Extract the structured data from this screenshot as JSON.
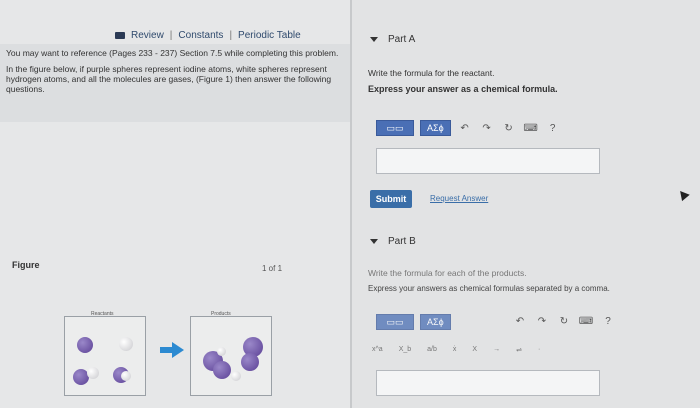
{
  "header": {
    "review_label": "Review",
    "constants_label": "Constants",
    "periodic_label": "Periodic Table",
    "separator": "|"
  },
  "reference": {
    "line1": "You may want to reference (Pages 233 - 237) Section 7.5 while completing this problem.",
    "line2": "In the figure below, if purple spheres represent iodine atoms, white spheres represent hydrogen atoms, and all the molecules are gases, (Figure 1) then answer the following questions."
  },
  "figure": {
    "label": "Figure",
    "page_count": "1 of 1",
    "reactants_caption": "Reactants",
    "products_caption": "Products"
  },
  "part_a": {
    "title": "Part A",
    "instruction": "Write the formula for the reactant.",
    "bold_instruction": "Express your answer as a chemical formula.",
    "answer_value": "",
    "greek_label": "ΑΣϕ",
    "help_label": "?",
    "submit_label": "Submit",
    "request_label": "Request Answer"
  },
  "part_b": {
    "title": "Part B",
    "instruction": "Write the formula for each of the products.",
    "bold_instruction": "Express your answers as chemical formulas separated by a comma.",
    "answer_value": "",
    "greek_label": "ΑΣϕ",
    "help_label": "?",
    "symbols": [
      "x^a",
      "X_b",
      "a/b",
      "ẋ",
      "X",
      "→",
      "⇌",
      "·"
    ]
  },
  "icons": {
    "undo": "↶",
    "redo": "↷",
    "reset": "↻",
    "keyboard": "⌨"
  },
  "colors": {
    "accent": "#3a6ea8",
    "iodine": "#5a3f94",
    "hydrogen": "#f2f2f2",
    "arrow": "#2c8ad1"
  }
}
